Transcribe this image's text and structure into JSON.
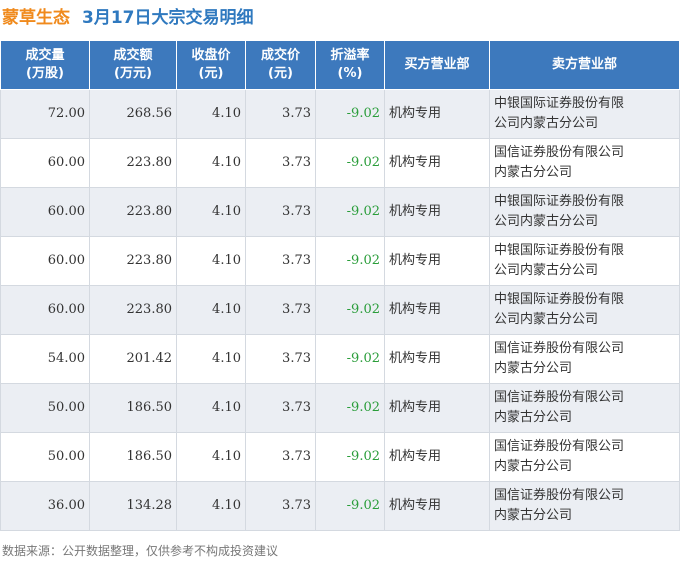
{
  "title": {
    "stock": "蒙草生态",
    "text": "3月17日大宗交易明细"
  },
  "table": {
    "headers": [
      {
        "line1": "成交量",
        "line2": "(万股)"
      },
      {
        "line1": "成交额",
        "line2": "(万元)"
      },
      {
        "line1": "收盘价",
        "line2": "(元)"
      },
      {
        "line1": "成交价",
        "line2": "(元)"
      },
      {
        "line1": "折溢率",
        "line2": "(%)"
      },
      {
        "line1": "买方营业部",
        "line2": ""
      },
      {
        "line1": "卖方营业部",
        "line2": ""
      }
    ],
    "rows": [
      {
        "volume": "72.00",
        "amount": "268.56",
        "close": "4.10",
        "price": "3.73",
        "premium": "-9.02",
        "buyer": "机构专用",
        "seller_1": "中银国际证券股份有限",
        "seller_2": "公司内蒙古分公司"
      },
      {
        "volume": "60.00",
        "amount": "223.80",
        "close": "4.10",
        "price": "3.73",
        "premium": "-9.02",
        "buyer": "机构专用",
        "seller_1": "国信证券股份有限公司",
        "seller_2": "内蒙古分公司"
      },
      {
        "volume": "60.00",
        "amount": "223.80",
        "close": "4.10",
        "price": "3.73",
        "premium": "-9.02",
        "buyer": "机构专用",
        "seller_1": "中银国际证券股份有限",
        "seller_2": "公司内蒙古分公司"
      },
      {
        "volume": "60.00",
        "amount": "223.80",
        "close": "4.10",
        "price": "3.73",
        "premium": "-9.02",
        "buyer": "机构专用",
        "seller_1": "中银国际证券股份有限",
        "seller_2": "公司内蒙古分公司"
      },
      {
        "volume": "60.00",
        "amount": "223.80",
        "close": "4.10",
        "price": "3.73",
        "premium": "-9.02",
        "buyer": "机构专用",
        "seller_1": "中银国际证券股份有限",
        "seller_2": "公司内蒙古分公司"
      },
      {
        "volume": "54.00",
        "amount": "201.42",
        "close": "4.10",
        "price": "3.73",
        "premium": "-9.02",
        "buyer": "机构专用",
        "seller_1": "国信证券股份有限公司",
        "seller_2": "内蒙古分公司"
      },
      {
        "volume": "50.00",
        "amount": "186.50",
        "close": "4.10",
        "price": "3.73",
        "premium": "-9.02",
        "buyer": "机构专用",
        "seller_1": "国信证券股份有限公司",
        "seller_2": "内蒙古分公司"
      },
      {
        "volume": "50.00",
        "amount": "186.50",
        "close": "4.10",
        "price": "3.73",
        "premium": "-9.02",
        "buyer": "机构专用",
        "seller_1": "国信证券股份有限公司",
        "seller_2": "内蒙古分公司"
      },
      {
        "volume": "36.00",
        "amount": "134.28",
        "close": "4.10",
        "price": "3.73",
        "premium": "-9.02",
        "buyer": "机构专用",
        "seller_1": "国信证券股份有限公司",
        "seller_2": "内蒙古分公司"
      }
    ]
  },
  "watermark": "证券之星",
  "footer": "数据来源：公开数据整理，仅供参考不构成投资建议",
  "colors": {
    "header_bg": "#3d79bd",
    "stock_name": "#f08a1c",
    "title": "#2f79bf",
    "negative": "#2a9d3a",
    "row_alt": "#ebeef3"
  }
}
